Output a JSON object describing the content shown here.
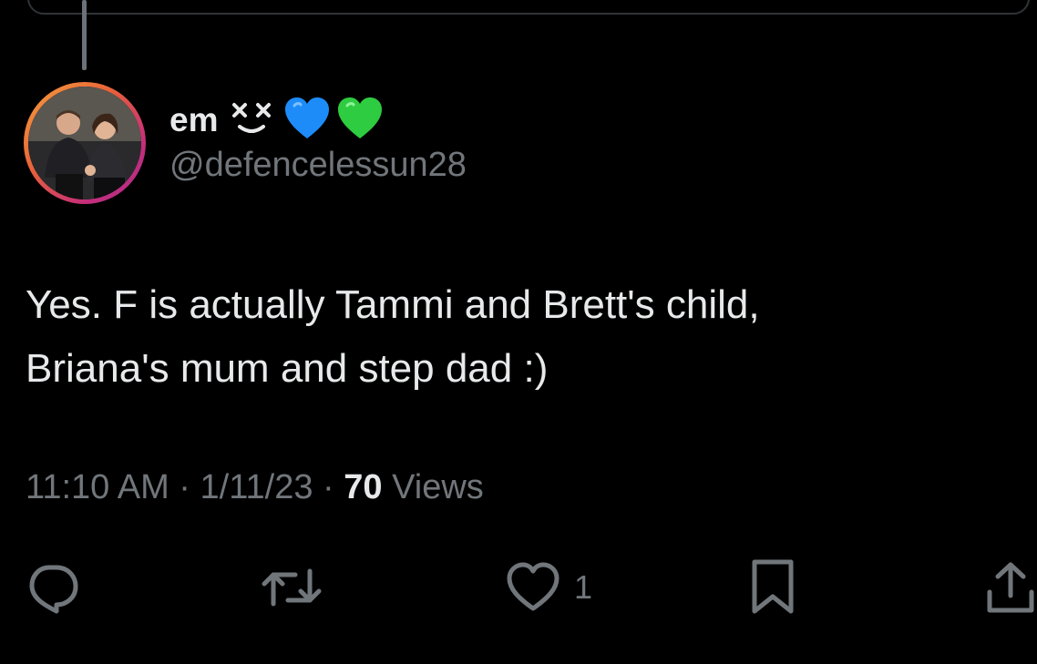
{
  "author": {
    "display_name": "em",
    "handle": "@defencelessun28",
    "name_emojis": [
      "face-with-crossed-out-eyes",
      "blue-heart",
      "green-heart"
    ]
  },
  "tweet": {
    "text_lines": [
      "Yes. F is actually Tammi and Brett's child,",
      "Briana's mum and step dad :)"
    ],
    "time": "11:10 AM",
    "separator": "·",
    "date": "1/11/23",
    "views_count": "70",
    "views_label": "Views"
  },
  "actions": {
    "reply_icon": "reply-icon",
    "retweet_icon": "retweet-icon",
    "like_icon": "heart-outline-icon",
    "like_count": "1",
    "bookmark_icon": "bookmark-icon",
    "share_icon": "share-icon"
  },
  "colors": {
    "background": "#000000",
    "primary_text": "#e7e9ea",
    "secondary_text": "#71767b",
    "blue_heart": "#1d8cf8",
    "green_heart": "#2ecc40"
  }
}
